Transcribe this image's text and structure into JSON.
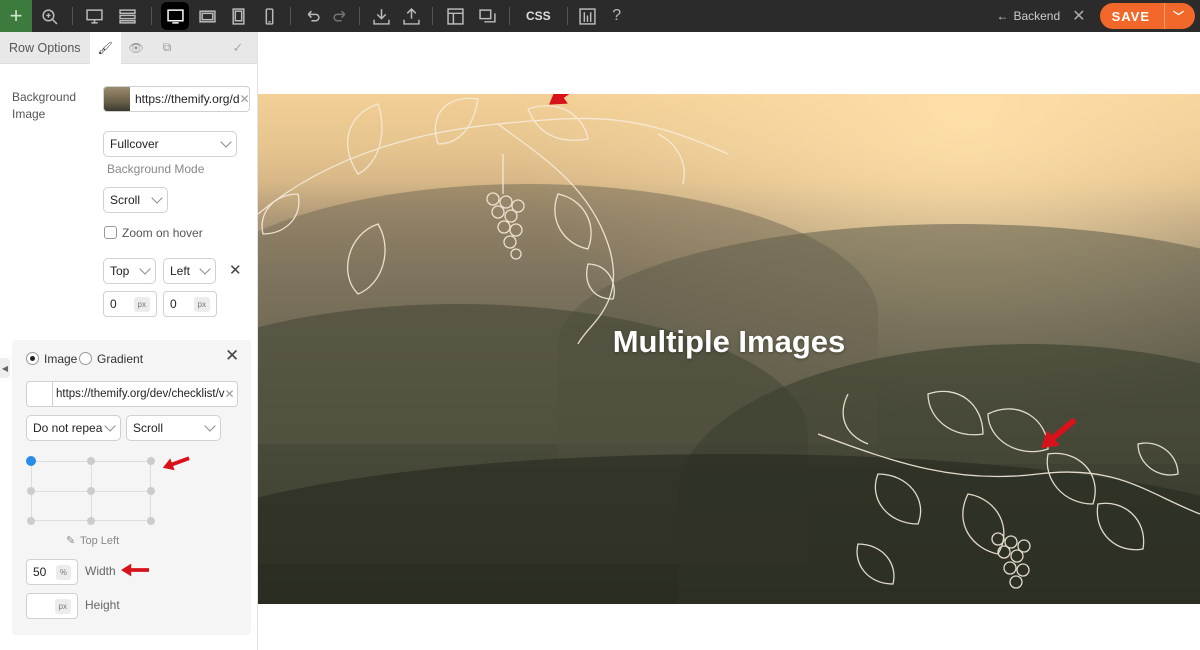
{
  "toolbar": {
    "icons": [
      "plus-icon",
      "zoom-icon",
      "desktop-icon",
      "layers-icon",
      "desktop-active-icon",
      "tablet-landscape-icon",
      "tablet-icon",
      "mobile-icon",
      "undo-icon",
      "redo-icon",
      "import-icon",
      "export-icon",
      "layout-icon",
      "duplicate-icon",
      "css",
      "revisions-icon",
      "help-icon"
    ],
    "css_label": "CSS",
    "help_label": "?",
    "backend_label": "Backend",
    "save_label": "SAVE",
    "accent": "#f2672a"
  },
  "panel": {
    "title": "Row Options",
    "background_image_label": "Background\nImage",
    "image_url": "https://themify.org/d",
    "bg_mode_value": "Fullcover",
    "bg_mode_caption": "Background Mode",
    "scroll_value": "Scroll",
    "zoom_label": "Zoom on hover",
    "pos_v": "Top",
    "pos_h": "Left",
    "offset_x": "0",
    "offset_y": "0",
    "unit_px": "px"
  },
  "subpanel": {
    "image_label": "Image",
    "gradient_label": "Gradient",
    "url": "https://themify.org/dev/checklist/v",
    "repeat_value": "Do not repea",
    "scroll_value": "Scroll",
    "position_label": "Top Left",
    "width_value": "50",
    "width_unit": "%",
    "width_label": "Width",
    "height_value": "",
    "height_unit": "px",
    "height_label": "Height"
  },
  "canvas": {
    "title": "Multiple Images"
  }
}
